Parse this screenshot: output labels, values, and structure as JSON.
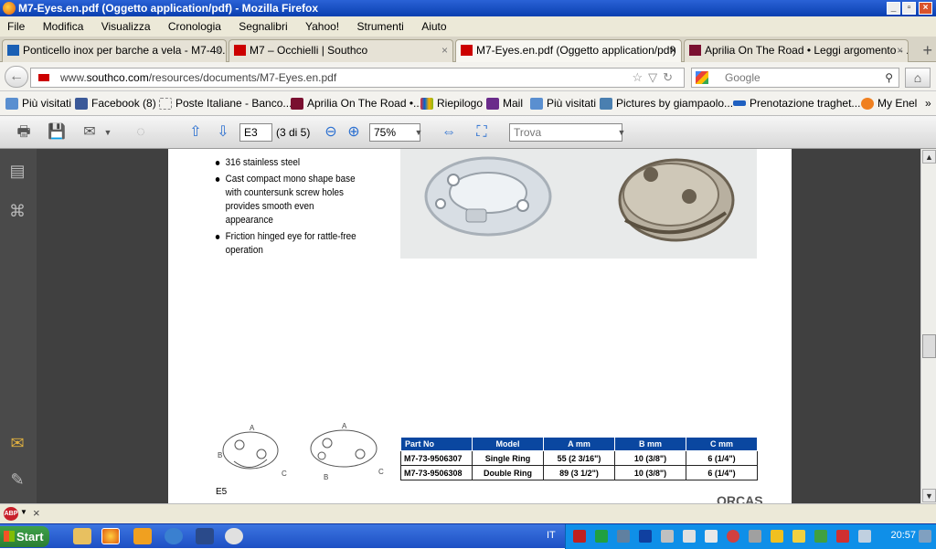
{
  "window": {
    "title": "M7-Eyes.en.pdf (Oggetto application/pdf) - Mozilla Firefox"
  },
  "menu": [
    "File",
    "Modifica",
    "Visualizza",
    "Cronologia",
    "Segnalibri",
    "Yahoo!",
    "Strumenti",
    "Aiuto"
  ],
  "tabs": [
    {
      "label": "Ponticello inox per barche a vela - M7-40...",
      "close": "×"
    },
    {
      "label": "M7 – Occhielli | Southco",
      "close": "×"
    },
    {
      "label": "M7-Eyes.en.pdf (Oggetto application/pdf)",
      "close": "×"
    },
    {
      "label": "Aprilia On The Road • Leggi argomento - ...",
      "close": "×"
    }
  ],
  "newtab": "+",
  "address": {
    "prefix": "www.",
    "host": "southco.com",
    "path": "/resources/documents/M7-Eyes.en.pdf"
  },
  "search": {
    "placeholder": "Google"
  },
  "bookmarks": [
    "Più visitati",
    "Facebook (8)",
    "Poste Italiane - Banco...",
    "Aprilia On The Road •...",
    "Riepilogo",
    "Mail",
    "Più visitati",
    "Pictures by giampaolo...",
    "Prenotazione traghet...",
    "My Enel"
  ],
  "bookmarks_more": "»",
  "pdf_toolbar": {
    "page_input": "E3",
    "page_count": "(3 di 5)",
    "zoom": "75%",
    "find_placeholder": "Trova"
  },
  "document": {
    "bullets": [
      "316 stainless steel",
      "Cast compact mono shape base with countersunk screw holes provides smooth even appearance",
      "Friction hinged eye for rattle-free operation"
    ],
    "table": {
      "headers": [
        "Part No",
        "Model",
        "A mm",
        "B mm",
        "C mm"
      ],
      "rows": [
        [
          "M7-73-9506307",
          "Single Ring",
          "55 (2 3/16\")",
          "10 (3/8\")",
          "6 (1/4\")"
        ],
        [
          "M7-73-9506308",
          "Double Ring",
          "89 (3 1/2\")",
          "10 (3/8\")",
          "6 (1/4\")"
        ]
      ]
    },
    "drawing_labels": [
      "A",
      "B",
      "C"
    ],
    "page_label": "E5",
    "brand": "ORCAS"
  },
  "addon_bar": {
    "close": "×"
  },
  "taskbar": {
    "start": "Start",
    "lang": "IT",
    "clock": "20:57"
  },
  "colors": {
    "titlebar": "#0a3fb0",
    "table_header": "#0a47a0",
    "taskbar": "#2458d2",
    "tray": "#0f8fe8"
  }
}
